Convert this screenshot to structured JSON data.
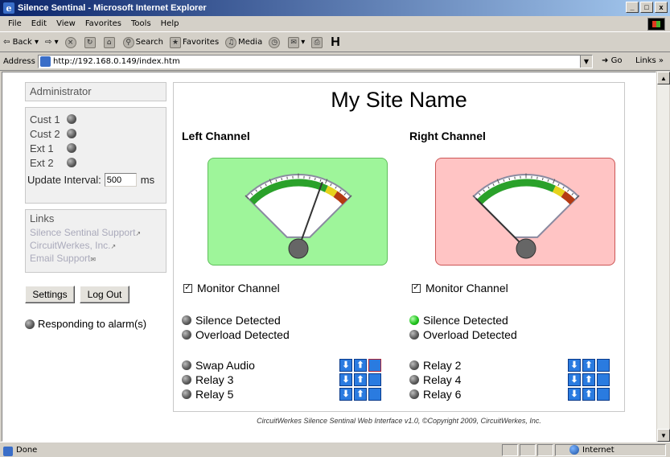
{
  "window": {
    "title": "Silence Sentinal - Microsoft Internet Explorer",
    "minimize": "_",
    "maximize": "□",
    "close": "x"
  },
  "menu": [
    "File",
    "Edit",
    "View",
    "Favorites",
    "Tools",
    "Help"
  ],
  "toolbar": {
    "back": "Back",
    "search": "Search",
    "favorites": "Favorites",
    "media": "Media",
    "h_icon": "H"
  },
  "address": {
    "label": "Address",
    "url": "http://192.168.0.149/index.htm",
    "go": "Go",
    "links": "Links"
  },
  "sidebar": {
    "admin_title": "Administrator",
    "status_items": [
      {
        "label": "Cust 1",
        "state": "off"
      },
      {
        "label": "Cust 2",
        "state": "off"
      },
      {
        "label": "Ext 1",
        "state": "off"
      },
      {
        "label": "Ext 2",
        "state": "off"
      }
    ],
    "update_interval_label": "Update Interval:",
    "update_interval_value": "500",
    "update_interval_unit": "ms",
    "links_title": "Links",
    "links": [
      "Silence Sentinal Support",
      "CircuitWerkes, Inc.",
      "Email Support"
    ],
    "settings_button": "Settings",
    "logout_button": "Log Out",
    "responding": "Responding to alarm(s)"
  },
  "main": {
    "site_name": "My Site Name",
    "left": {
      "title": "Left Channel",
      "meter_level": 0.72,
      "monitor_label": "Monitor Channel",
      "monitor_checked": true,
      "silence": {
        "label": "Silence Detected",
        "state": "off"
      },
      "overload": {
        "label": "Overload Detected",
        "state": "off"
      },
      "relays": [
        {
          "label": "Swap Audio",
          "state": "off"
        },
        {
          "label": "Relay 3",
          "state": "off"
        },
        {
          "label": "Relay 5",
          "state": "off"
        }
      ]
    },
    "right": {
      "title": "Right Channel",
      "meter_level": 0.0,
      "monitor_label": "Monitor Channel",
      "monitor_checked": true,
      "silence": {
        "label": "Silence Detected",
        "state": "on"
      },
      "overload": {
        "label": "Overload Detected",
        "state": "off"
      },
      "relays": [
        {
          "label": "Relay 2",
          "state": "off"
        },
        {
          "label": "Relay 4",
          "state": "off"
        },
        {
          "label": "Relay 6",
          "state": "off"
        }
      ]
    },
    "footer": "CircuitWerkes Silence Sentinal Web Interface v1.0, ©Copyright 2009, CircuitWerkes, Inc."
  },
  "status": {
    "text": "Done",
    "zone": "Internet"
  },
  "colors": {
    "meter_ok": "#9ef59a",
    "meter_alarm": "#ffc4c4",
    "led_on": "#22c41e",
    "control_blue": "#2a7be0"
  }
}
